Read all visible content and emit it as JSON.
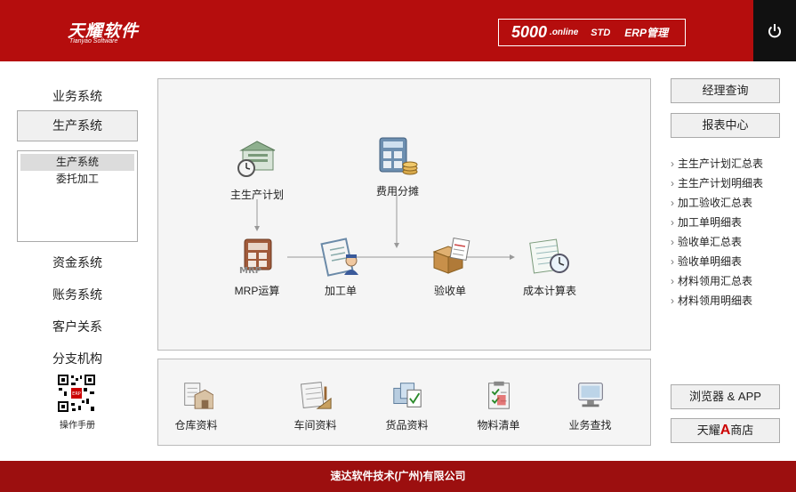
{
  "header": {
    "logo_cn": "天耀软件",
    "logo_en": "Tianyao Software",
    "product": {
      "version": "5000",
      "online": ".online",
      "std": "STD",
      "erp": "ERP管理"
    }
  },
  "sidebar": {
    "items": [
      "业务系统",
      "资金系统",
      "账务系统",
      "客户关系",
      "分支机构"
    ],
    "active": "生产系统",
    "sub_items": [
      "生产系统",
      "委托加工"
    ],
    "qr_label": "操作手册"
  },
  "flow": {
    "nodes": [
      "主生产计划",
      "费用分摊",
      "MRP运算",
      "加工单",
      "验收单",
      "成本计算表"
    ]
  },
  "bottom": {
    "items": [
      "仓库资料",
      "车间资料",
      "货品资料",
      "物料清单",
      "业务查找"
    ]
  },
  "right": {
    "manager_query": "经理查询",
    "report_center": "报表中心",
    "reports": [
      "主生产计划汇总表",
      "主生产计划明细表",
      "加工验收汇总表",
      "加工单明细表",
      "验收单汇总表",
      "验收单明细表",
      "材料领用汇总表",
      "材料领用明细表"
    ],
    "browser_app": "浏览器 & APP",
    "store_prefix": "天耀",
    "store_letter": "A",
    "store_suffix": "商店"
  },
  "footer": {
    "company": "速达软件技术(广州)有限公司"
  },
  "colors": {
    "brand": "#b50d0d",
    "footer": "#9c0f0f"
  }
}
